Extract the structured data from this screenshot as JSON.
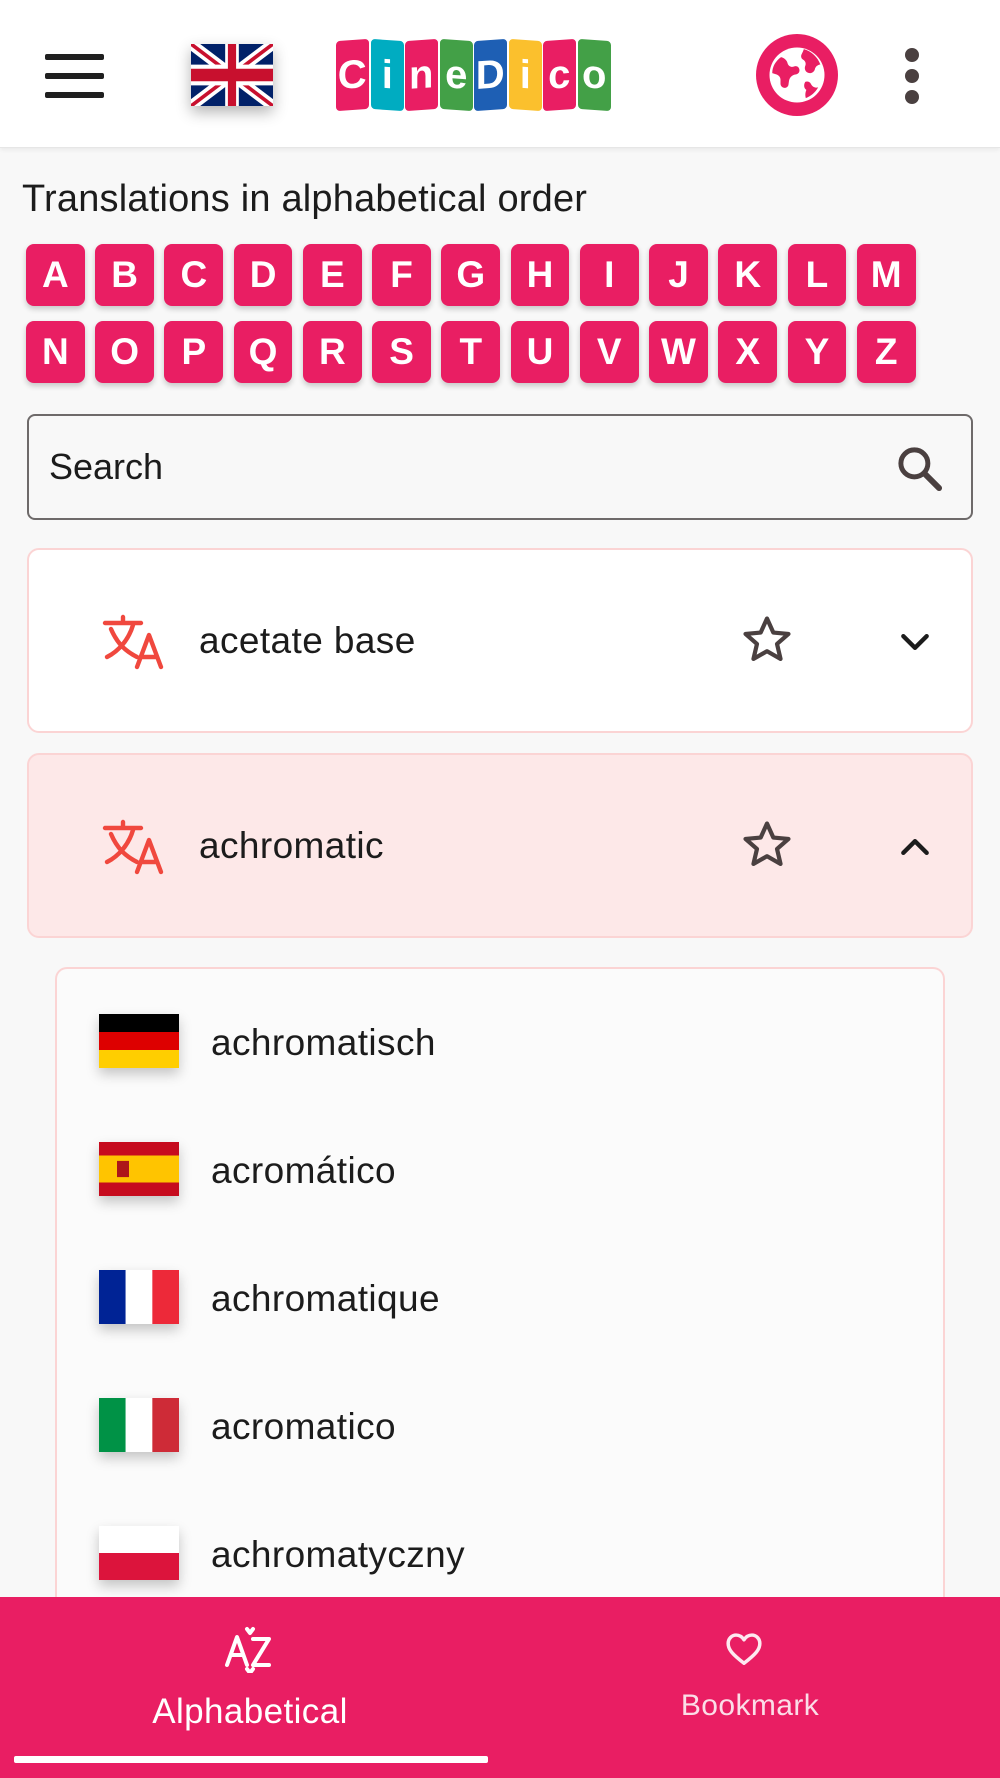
{
  "header": {
    "menu_icon": "hamburger-menu-icon",
    "language_flag_icon": "uk-flag-icon",
    "logo": {
      "letters": [
        "C",
        "i",
        "n",
        "e",
        "D",
        "i",
        "c",
        "o"
      ],
      "colors": [
        "#e91e63",
        "#ffffff",
        "#e91e63",
        "#00acc1",
        "#43a047",
        "#1e5fb4",
        "#e53935",
        "#fbc02d",
        "#e91e63",
        "#00acc1",
        "#43a047"
      ]
    },
    "globe_icon": "globe-icon",
    "more_icon": "more-vert-icon"
  },
  "page": {
    "title": "Translations in alphabetical order"
  },
  "alphabet": {
    "row1": [
      "A",
      "B",
      "C",
      "D",
      "E",
      "F",
      "G",
      "H",
      "I",
      "J",
      "K",
      "L",
      "M"
    ],
    "row2": [
      "N",
      "O",
      "P",
      "Q",
      "R",
      "S",
      "T",
      "U",
      "V",
      "W",
      "X",
      "Y",
      "Z"
    ]
  },
  "search": {
    "placeholder": "Search",
    "icon": "search-icon"
  },
  "terms": [
    {
      "label": "acetate base",
      "expanded": false,
      "icon": "translate-icon",
      "bookmark_icon": "star-outline-icon",
      "toggle_icon": "chevron-down-icon"
    },
    {
      "label": "achromatic",
      "expanded": true,
      "icon": "translate-icon",
      "bookmark_icon": "star-outline-icon",
      "toggle_icon": "chevron-up-icon"
    }
  ],
  "translations": [
    {
      "flag": "german-flag-icon",
      "text": "achromatisch"
    },
    {
      "flag": "spanish-flag-icon",
      "text": "acromático"
    },
    {
      "flag": "french-flag-icon",
      "text": "achromatique"
    },
    {
      "flag": "italian-flag-icon",
      "text": "acromatico"
    },
    {
      "flag": "polish-flag-icon",
      "text": "achromatyczny"
    }
  ],
  "bottom_nav": {
    "items": [
      {
        "label": "Alphabetical",
        "icon": "sort-alphabetical-icon",
        "active": true
      },
      {
        "label": "Bookmark",
        "icon": "heart-outline-icon",
        "active": false
      }
    ]
  },
  "colors": {
    "accent": "#e91e63",
    "expanded_card_bg": "#fde8e8",
    "card_border": "#fbd4d4",
    "translate_icon": "#f0483e"
  }
}
